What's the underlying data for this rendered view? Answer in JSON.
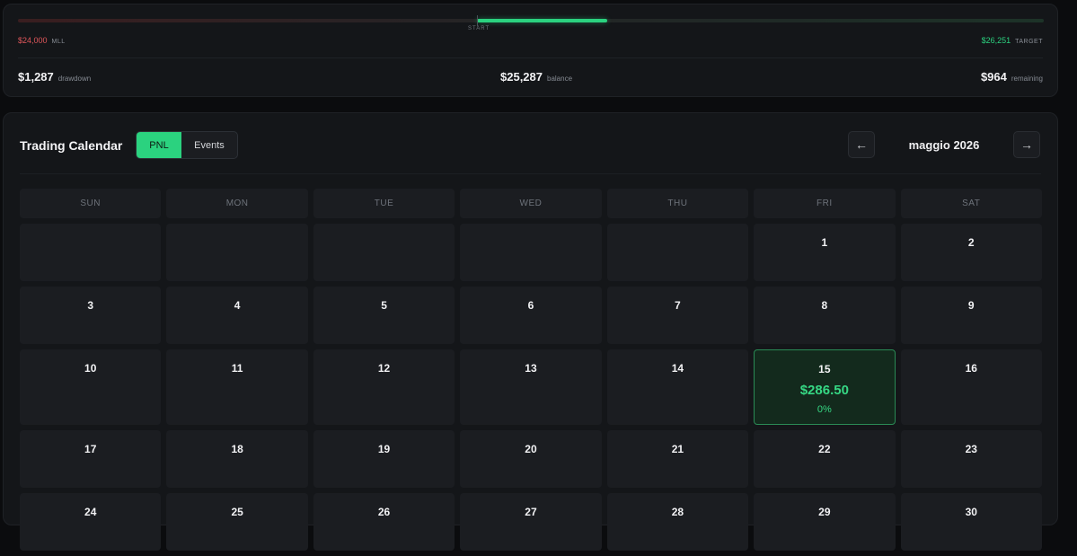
{
  "progress": {
    "start_label": "START",
    "fill_start_fraction": 0.4475,
    "fill_end_fraction": 0.5748,
    "mll": {
      "value": "$24,000",
      "label": "MLL"
    },
    "target": {
      "value": "$26,251",
      "label": "TARGET"
    },
    "stats": {
      "drawdown": {
        "value": "$1,287",
        "label": "drawdown"
      },
      "balance": {
        "value": "$25,287",
        "label": "balance"
      },
      "remaining": {
        "value": "$964",
        "label": "remaining"
      }
    }
  },
  "calendar": {
    "title": "Trading Calendar",
    "toggle": {
      "pnl": "PNL",
      "events": "Events",
      "active": "PNL"
    },
    "prev_arrow": "←",
    "next_arrow": "→",
    "month": "maggio 2026",
    "weekdays": [
      "SUN",
      "MON",
      "TUE",
      "WED",
      "THU",
      "FRI",
      "SAT"
    ],
    "weeks": [
      [
        null,
        null,
        null,
        null,
        null,
        "1",
        "2"
      ],
      [
        "3",
        "4",
        "5",
        "6",
        "7",
        "8",
        "9"
      ],
      [
        "10",
        "11",
        "12",
        "13",
        "14",
        "15",
        "16"
      ],
      [
        "17",
        "18",
        "19",
        "20",
        "21",
        "22",
        "23"
      ],
      [
        "24",
        "25",
        "26",
        "27",
        "28",
        "29",
        "30"
      ]
    ],
    "pnl_days": {
      "15": {
        "amount": "$286.50",
        "percent": "0%"
      }
    },
    "colors": {
      "accent": "#2bd27f",
      "loss": "#e0575b",
      "panel": "#141619",
      "cell": "#1b1d21"
    }
  }
}
